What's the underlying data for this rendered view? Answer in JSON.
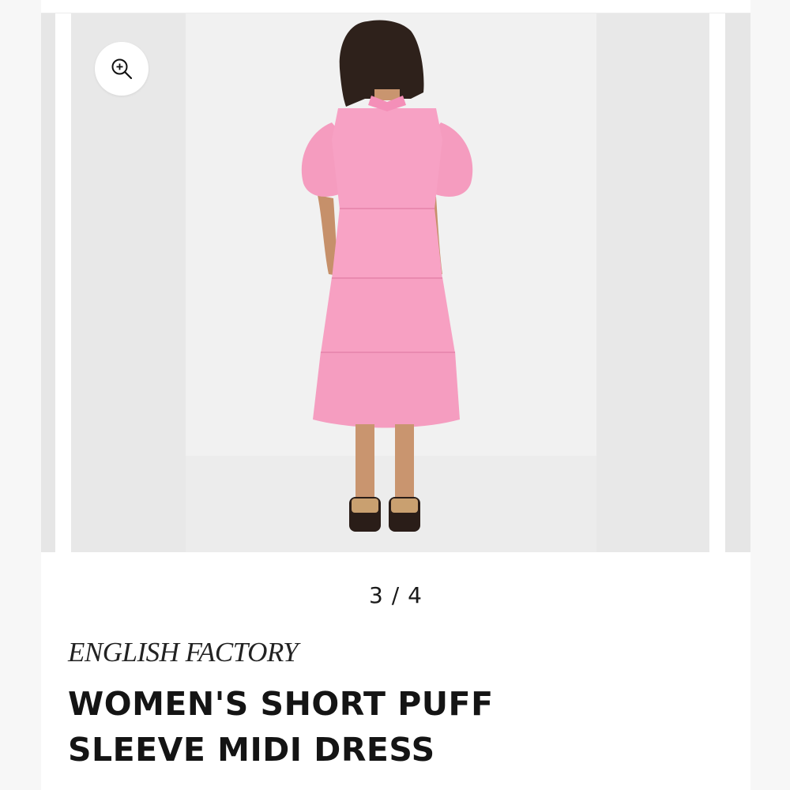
{
  "gallery": {
    "current_index": 3,
    "total": 4,
    "counter_separator": "/",
    "zoom_icon": "zoom-in-icon",
    "image_subject": "woman-pink-tiered-midi-dress-back-view",
    "dress_color": "#f7a1c4",
    "background_color": "#e8e8e8"
  },
  "product": {
    "brand": "ENGLISH FACTORY",
    "title_line1": "WOMEN'S SHORT PUFF",
    "title_line2": "SLEEVE MIDI DRESS"
  }
}
